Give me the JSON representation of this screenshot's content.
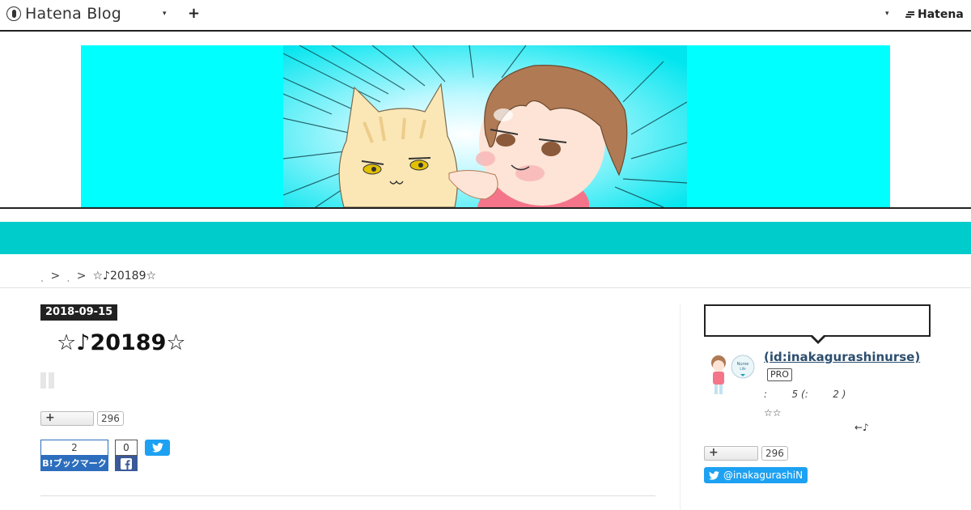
{
  "topbar": {
    "logo_text": "Hatena Blog",
    "add_label": "+",
    "dropdown_glyph": "▾",
    "brand_text": "Hatena"
  },
  "breadcrumb": {
    "dot1": "˛",
    "dot2": "˛",
    "separator": ">",
    "current": "☆♪20189☆"
  },
  "article": {
    "date": "2018-09-15",
    "title": "☆♪20189☆",
    "star_add": "+",
    "star_count": "296",
    "bookmark_count": "2",
    "bookmark_label": "B!ブックマーク",
    "facebook_count": "0"
  },
  "sidebar": {
    "profile_id": " (id:inakagurashinurse)",
    "pro_badge": "PRO",
    "line1": ":        5 (:        2 )",
    "line2": "☆☆",
    "line3": "←♪",
    "star_add": "+",
    "star_count": "296",
    "twitter_follow": "@inakagurashiN"
  },
  "colors": {
    "header_cyan": "#00ffff",
    "nav_band": "#00cccc",
    "hatena_blue": "#2c6ebd",
    "facebook_blue": "#3b5998",
    "twitter_blue": "#1da1f2",
    "date_badge_bg": "#222222"
  }
}
